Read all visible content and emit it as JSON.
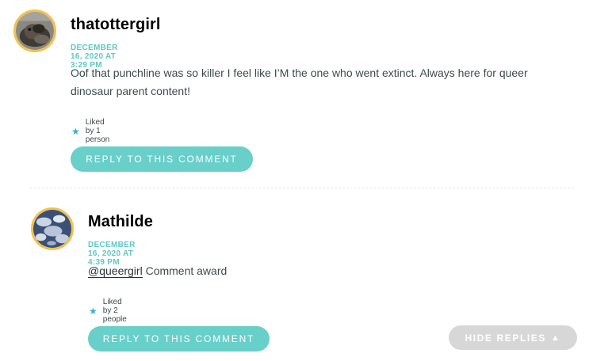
{
  "comments": [
    {
      "author": "thatottergirl",
      "date": "DECEMBER 16, 2020 AT 3:29 PM",
      "text": "Oof that punchline was so killer I feel like I’M the one who went extinct. Always here for queer dinosaur parent content!",
      "likes": "Liked by 1 person",
      "reply_label": "REPLY TO THIS COMMENT",
      "avatar_icon": "otter-photo-avatar"
    },
    {
      "author": "Mathilde",
      "date": "DECEMBER 16, 2020 AT 4:39 PM",
      "mention": "@queergirl",
      "text": " Comment award",
      "likes": "Liked by 2 people",
      "reply_label": "REPLY TO THIS COMMENT",
      "avatar_icon": "sky-clouds-avatar"
    }
  ],
  "hide_replies": {
    "label": "HIDE REPLIES",
    "icon": "▲"
  },
  "colors": {
    "accent": "#68cfc9",
    "date": "#5fc7c6",
    "avatar_border": "#f2c14e",
    "like_star": "#3aaed8",
    "hide_button": "#d7d7d7"
  },
  "like_icon": "star-icon"
}
